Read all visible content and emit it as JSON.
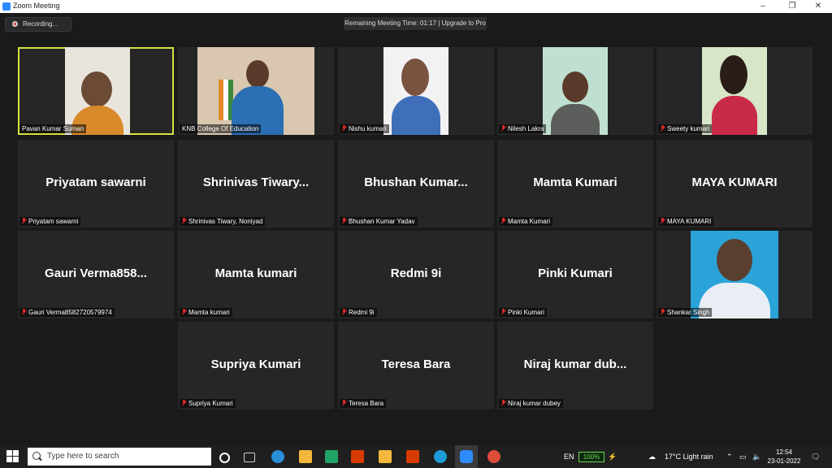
{
  "window": {
    "title": "Zoom Meeting"
  },
  "controls": {
    "minimize": "–",
    "maximize": "❐",
    "close": "✕"
  },
  "recording": {
    "label": "Recording..."
  },
  "timer": {
    "text": "Remaining Meeting Time: 01:17 | Upgrade to Pro"
  },
  "participants": [
    {
      "name": "Pavan Kumar Suman",
      "video": true,
      "active": true
    },
    {
      "name": "KNB College Of Education",
      "video": true
    },
    {
      "name": "Nishu kumari",
      "video": true
    },
    {
      "name": "Nilesh Lakra",
      "video": true
    },
    {
      "name": "Sweety kumari",
      "video": true
    },
    {
      "display": "Priyatam sawarni",
      "name": "Priyatam sawarni"
    },
    {
      "display": "Shrinivas  Tiwary...",
      "name": "Shrinivas Tiwary, Noniyad"
    },
    {
      "display": "Bhushan  Kumar...",
      "name": "Bhushan Kumar Yadav"
    },
    {
      "display": "Mamta Kumari",
      "name": "Mamta Kumari"
    },
    {
      "display": "MAYA KUMARI",
      "name": "MAYA KUMARI"
    },
    {
      "display": "Gauri  Verma858...",
      "name": "Gauri Verma8582720579974"
    },
    {
      "display": "Mamta kumari",
      "name": "Mamta kumari"
    },
    {
      "display": "Redmi 9i",
      "name": "Redmi 9i"
    },
    {
      "display": "Pinki Kumari",
      "name": "Pinki Kumari"
    },
    {
      "name": "Shankar Singh",
      "video": true
    },
    {
      "display": "Supriya Kumari",
      "name": "Supriya Kumari"
    },
    {
      "display": "Teresa Bara",
      "name": "Teresa Bara"
    },
    {
      "display": "Niraj  kumar  dub...",
      "name": "Niraj kumar dubey"
    }
  ],
  "taskbar": {
    "search_placeholder": "Type here to search",
    "lang": "EN",
    "battery": "100%",
    "weather": "17°C  Light rain",
    "time": "12:54",
    "date": "23-01-2022",
    "colors": {
      "zoom": "#2d8cff",
      "edge": "#1d9ad6",
      "chrome": "#dd4b39",
      "explorer": "#f3b83d",
      "excel": "#21a366",
      "office": "#d83b01"
    }
  }
}
